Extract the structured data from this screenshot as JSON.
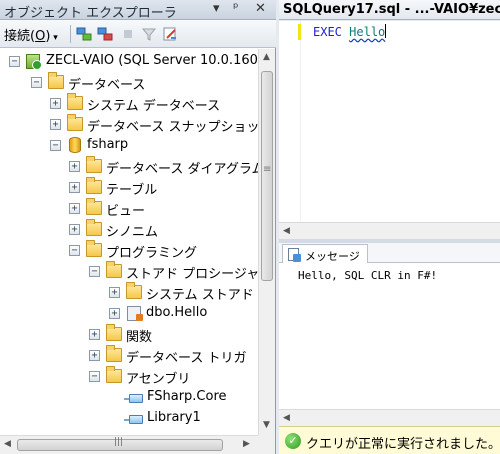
{
  "object_explorer": {
    "title": "オブジェクト エクスプローラ",
    "pin_glyph": "▾ ᵖ ✕",
    "connect_label": "接続(",
    "connect_key": "O",
    "connect_suffix": ")"
  },
  "tree": [
    {
      "label": "ZECL-VAIO (SQL Server 10.0.160",
      "icon": "server-icon",
      "expander": "−"
    },
    {
      "label": "データベース",
      "icon": "folder-icon",
      "expander": "−"
    },
    {
      "label": "システム データベース",
      "icon": "folder-icon",
      "expander": "+"
    },
    {
      "label": "データベース スナップショッ",
      "icon": "folder-icon",
      "expander": "+"
    },
    {
      "label": "fsharp",
      "icon": "database-icon",
      "expander": "−"
    },
    {
      "label": "データベース ダイアグラム",
      "icon": "folder-icon",
      "expander": "+"
    },
    {
      "label": "テーブル",
      "icon": "folder-icon",
      "expander": "+"
    },
    {
      "label": "ビュー",
      "icon": "folder-icon",
      "expander": "+"
    },
    {
      "label": "シノニム",
      "icon": "folder-icon",
      "expander": "+"
    },
    {
      "label": "プログラミング",
      "icon": "folder-icon",
      "expander": "−"
    },
    {
      "label": "ストアド プロシージャ",
      "icon": "folder-icon",
      "expander": "−"
    },
    {
      "label": "システム ストアド",
      "icon": "folder-icon",
      "expander": "+"
    },
    {
      "label": "dbo.Hello",
      "icon": "stored-procedure-icon",
      "expander": "+"
    },
    {
      "label": "関数",
      "icon": "folder-icon",
      "expander": "+"
    },
    {
      "label": "データベース トリガ",
      "icon": "folder-icon",
      "expander": "+"
    },
    {
      "label": "アセンブリ",
      "icon": "folder-icon",
      "expander": "−"
    },
    {
      "label": "FSharp.Core",
      "icon": "assembly-icon",
      "expander": ""
    },
    {
      "label": "Library1",
      "icon": "assembly-icon",
      "expander": ""
    }
  ],
  "query": {
    "tab_title": "SQLQuery17.sql - ...-VAIO¥zec",
    "keyword": "EXEC",
    "identifier": "Hello"
  },
  "messages": {
    "tab_label": "メッセージ",
    "lines": [
      "Hello, SQL CLR in F#!"
    ]
  },
  "status": {
    "text": "クエリが正常に実行されました。"
  },
  "colors": {
    "keyword": "#1f1fd6",
    "status_bg": "#fffbd6",
    "success": "#2e9a1a"
  }
}
